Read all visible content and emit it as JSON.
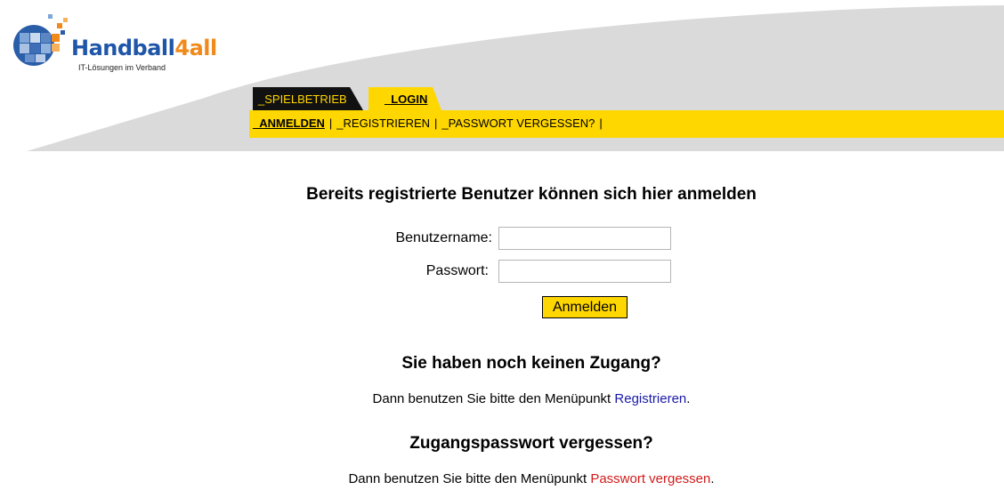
{
  "logo": {
    "name_part1": "Handball",
    "name_part2": "4",
    "name_part3": "all",
    "tagline": "IT-Lösungen im Verband"
  },
  "tabs": [
    {
      "label": "_SPIELBETRIEB",
      "active": false
    },
    {
      "label": "_LOGIN",
      "active": true
    }
  ],
  "subnav": [
    {
      "label": "_ANMELDEN",
      "active": true
    },
    {
      "label": "_REGISTRIEREN",
      "active": false
    },
    {
      "label": "_PASSWORT VERGESSEN?",
      "active": false
    }
  ],
  "login": {
    "heading": "Bereits registrierte Benutzer können sich hier anmelden",
    "username_label": "Benutzername:",
    "username_value": "",
    "password_label": "Passwort:",
    "password_value": "",
    "submit_label": "Anmelden"
  },
  "register": {
    "heading": "Sie haben noch keinen Zugang?",
    "text_before": "Dann benutzen Sie bitte den Menüpunkt ",
    "link": "Registrieren",
    "text_after": "."
  },
  "forgot": {
    "heading": "Zugangspasswort vergessen?",
    "text_before": "Dann benutzen Sie bitte den Menüpunkt ",
    "link": "Passwort vergessen",
    "text_after": "."
  },
  "colors": {
    "brand_yellow": "#ffd700",
    "brand_blue": "#1f56a8",
    "brand_orange": "#f08a1c",
    "link_blue": "#1a1aa8",
    "link_red": "#d11b1b"
  }
}
